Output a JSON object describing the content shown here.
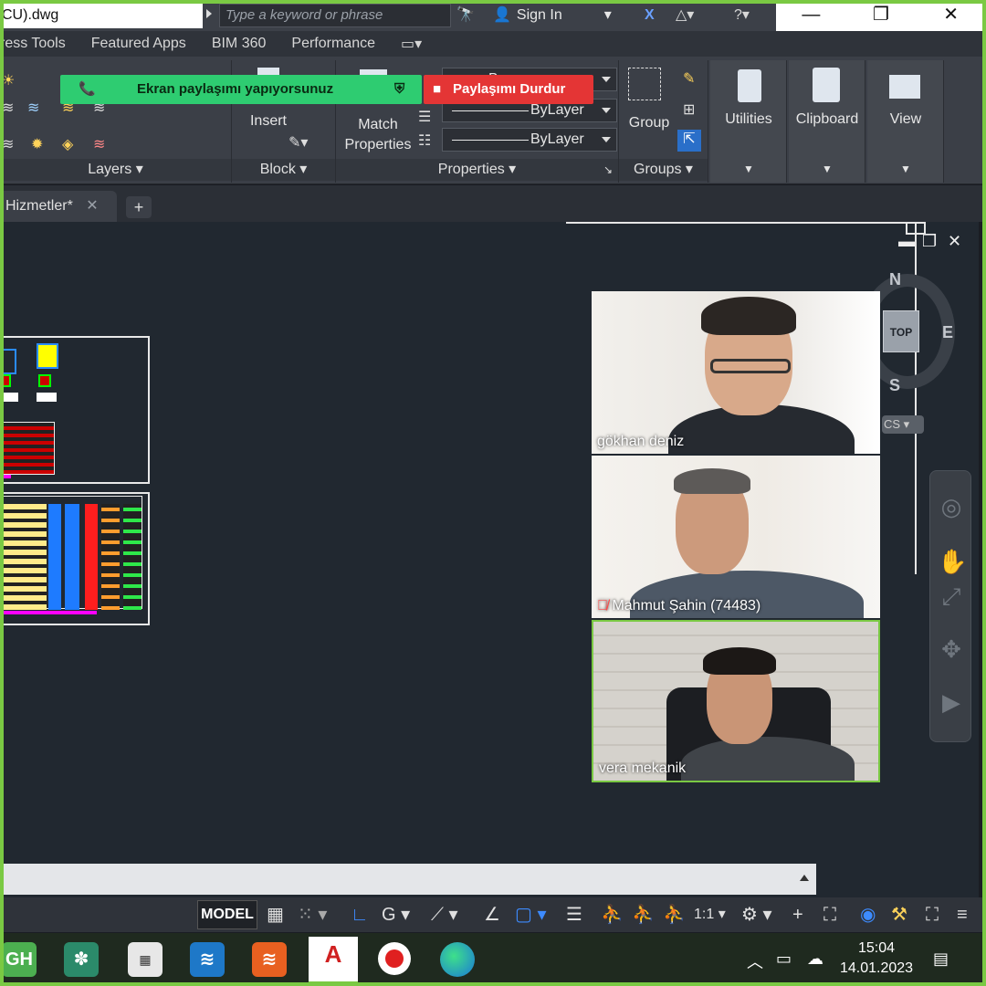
{
  "titlebar": {
    "file_title": "CU).dwg",
    "search_placeholder": "Type a keyword or phrase",
    "signin_label": "Sign In",
    "minimize": "—",
    "restore": "❐",
    "close": "✕"
  },
  "ribbon_tabs": [
    "ress Tools",
    "Featured Apps",
    "BIM 360",
    "Performance"
  ],
  "ribbon": {
    "layers_label": "Layers",
    "block_label": "Block",
    "insert_label": "Insert",
    "match_label_1": "Match",
    "match_label_2": "Properties",
    "properties_label": "Properties",
    "bylayer_1": "ByLayer",
    "bylayer_2": "ByLayer",
    "group_label": "Group",
    "groups_label": "Groups",
    "utilities_label": "Utilities",
    "clipboard_label": "Clipboard",
    "view_label": "View",
    "top_dd_partial": "B..."
  },
  "sharing": {
    "message": "Ekran paylaşımı yapıyorsunuz",
    "stop_label": "Paylaşımı Durdur"
  },
  "file_tab": {
    "label": "Hizmetler*",
    "close": "✕",
    "new_tab": "+"
  },
  "viewcube": {
    "north": "N",
    "east": "E",
    "south": "S",
    "top": "TOP",
    "wcs": "CS"
  },
  "participants": [
    {
      "name": "gökhan deniz",
      "muted": false
    },
    {
      "name": "Mahmut Şahin (74483)",
      "muted": true
    },
    {
      "name": "vera mekanik",
      "muted": false
    }
  ],
  "statusbar": {
    "model_label": "MODEL",
    "scale_label": "1:1"
  },
  "taskbar": {
    "time": "15:04",
    "date": "14.01.2023",
    "apps": [
      "GH",
      "fan-app",
      "cado-app",
      "folder-app",
      "stack-app",
      "A",
      "record-app",
      "edge-app"
    ]
  },
  "colors": {
    "share_green": "#2ecc71",
    "stop_red": "#e43535",
    "frame_green": "#7ac943",
    "canvas_bg": "#212830"
  }
}
